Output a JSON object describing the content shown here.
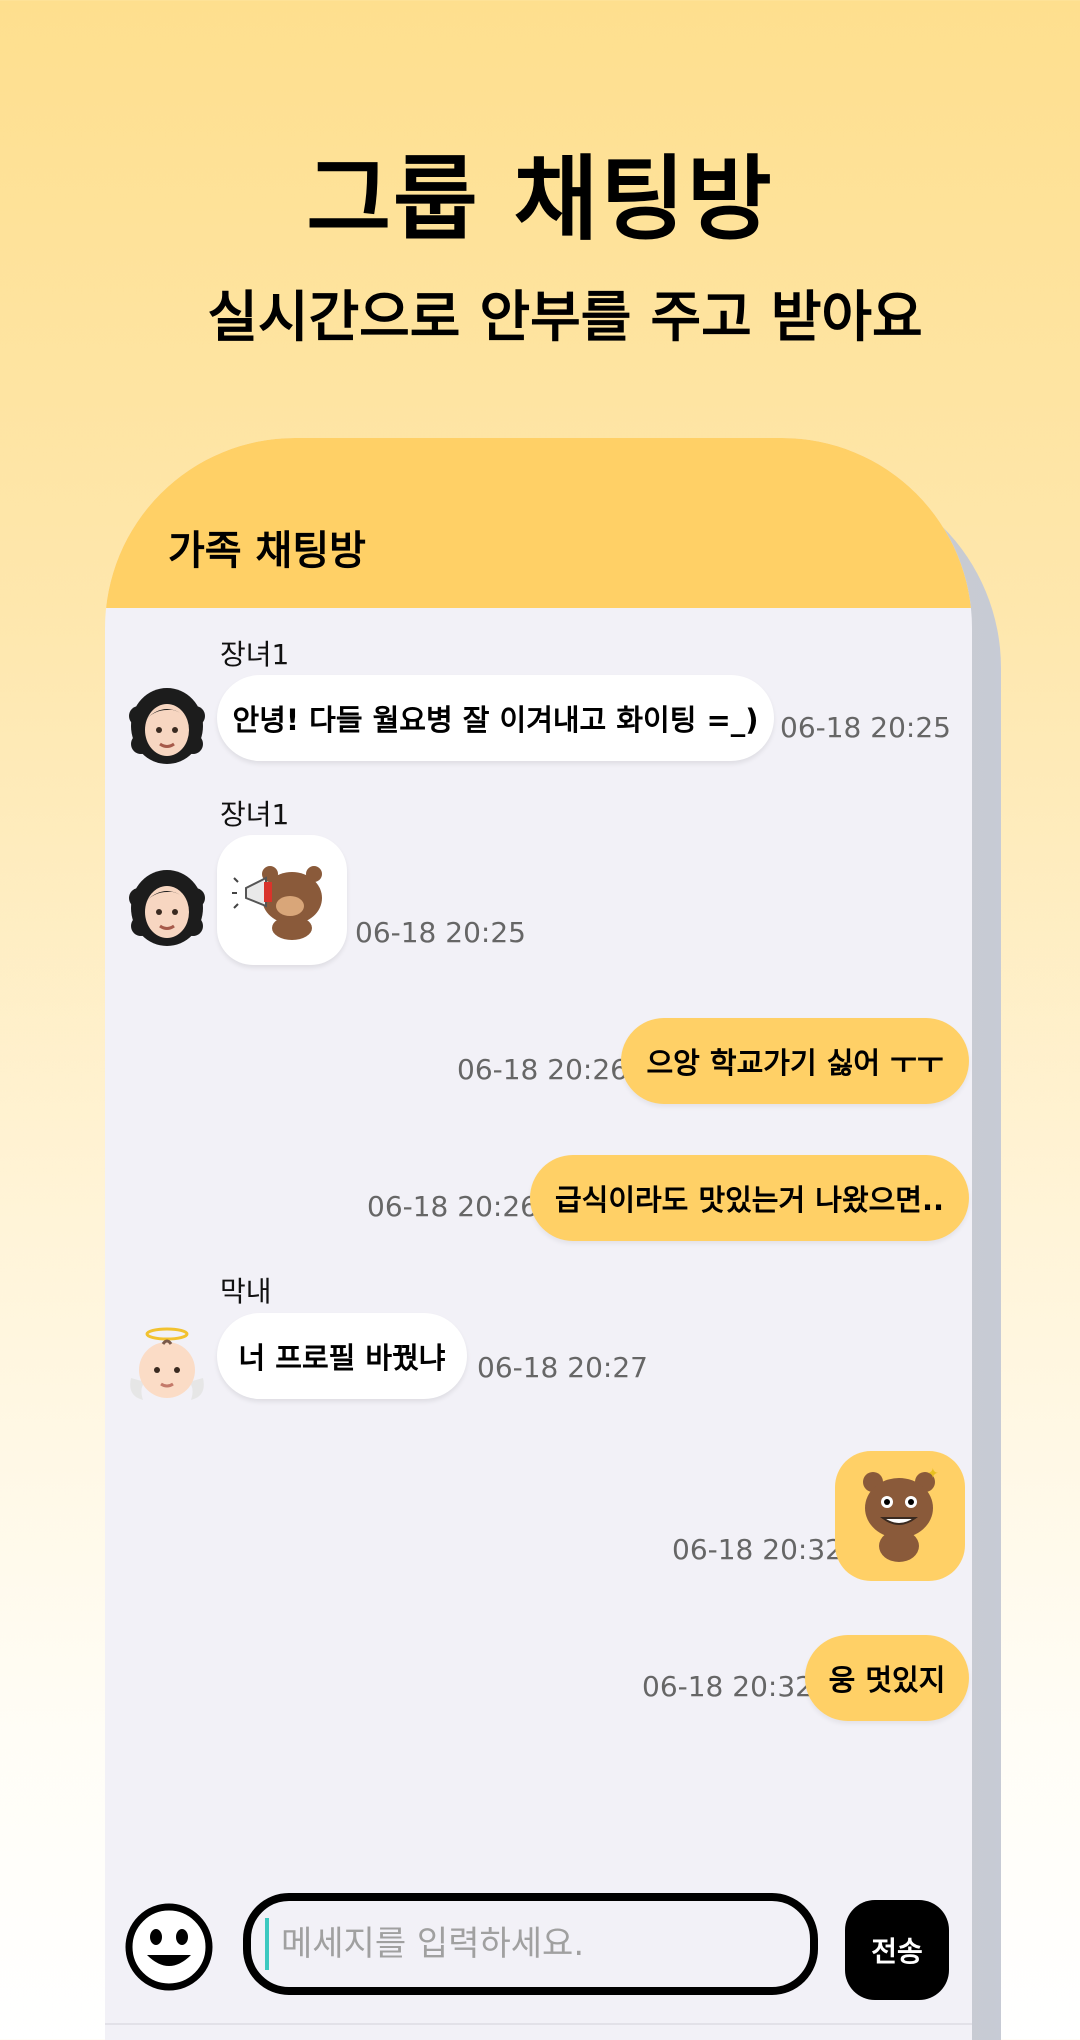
{
  "promo": {
    "title": "그룹 채팅방",
    "subtitle": "실시간으로 안부를 주고 받아요"
  },
  "room": {
    "title": "가족 채팅방"
  },
  "messages": [
    {
      "sender": "장녀1",
      "type": "text",
      "text": "안녕! 다들 월요병 잘 이겨내고 화이팅 =_)",
      "time": "06-18 20:25",
      "direction": "in"
    },
    {
      "sender": "장녀1",
      "type": "sticker",
      "sticker": "bear-megaphone-sticker",
      "time": "06-18 20:25",
      "direction": "in"
    },
    {
      "type": "text",
      "text": "으앙 학교가기 싫어 ㅜㅜ",
      "time": "06-18 20:26",
      "direction": "out"
    },
    {
      "type": "text",
      "text": "급식이라도 맛있는거 나왔으면..",
      "time": "06-18 20:26",
      "direction": "out"
    },
    {
      "sender": "막내",
      "type": "text",
      "text": "너 프로필 바꿨냐",
      "time": "06-18 20:27",
      "direction": "in"
    },
    {
      "type": "sticker",
      "sticker": "bear-grin-sticker",
      "time": "06-18 20:32",
      "direction": "out"
    },
    {
      "type": "text",
      "text": "웅 멋있지",
      "time": "06-18 20:32",
      "direction": "out"
    }
  ],
  "composer": {
    "placeholder": "메세지를 입력하세요.",
    "send_label": "전송",
    "emoji_icon": "smiley-icon"
  },
  "colors": {
    "accent_yellow": "#ffd066",
    "chat_bg": "#f2f1f7",
    "time_gray": "#666666"
  }
}
